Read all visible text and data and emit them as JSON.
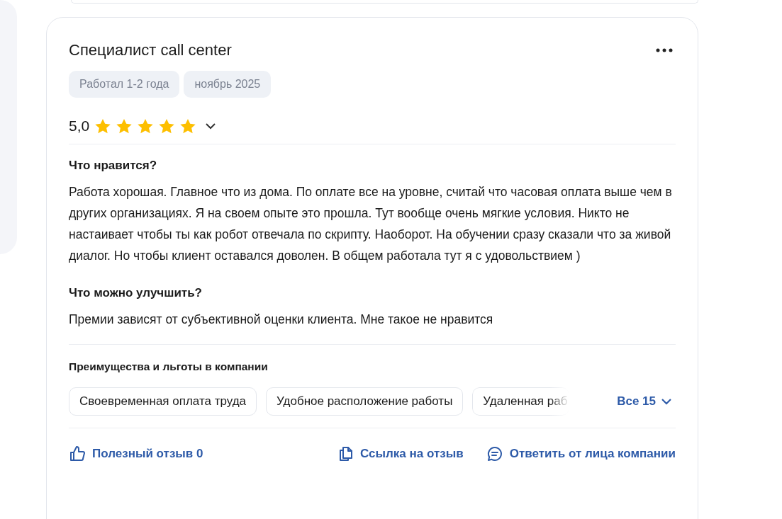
{
  "review": {
    "title": "Специалист call center",
    "tags": [
      "Работал 1-2 года",
      "ноябрь 2025"
    ],
    "rating": "5,0",
    "stars": 5,
    "sections": [
      {
        "heading": "Что нравится?",
        "text": "Работа хорошая. Главное что из дома. По оплате все на уровне, считай что часовая оплата выше чем в других организациях. Я на своем опыте это прошла. Тут вообще очень мягкие условия. Никто не настаивает чтобы ты как робот отвечала по скрипту. Наоборот. На обучении сразу сказали что за живой диалог. Но чтобы клиент оставался доволен. В общем работала тут я с удовольствием )"
      },
      {
        "heading": "Что можно улучшить?",
        "text": "Премии зависят от субъективной оценки клиента. Мне такое не нравится"
      }
    ],
    "benefits": {
      "heading": "Преимущества и льготы в компании",
      "items": [
        "Своевременная оплата труда",
        "Удобное расположение работы",
        "Удаленная раб"
      ],
      "more": "Все 15"
    },
    "actions": [
      {
        "kind": "like",
        "label": "Полезный отзыв 0"
      },
      {
        "kind": "link",
        "label": "Ссылка на отзыв"
      },
      {
        "kind": "reply",
        "label": "Ответить от лица компании"
      }
    ]
  }
}
